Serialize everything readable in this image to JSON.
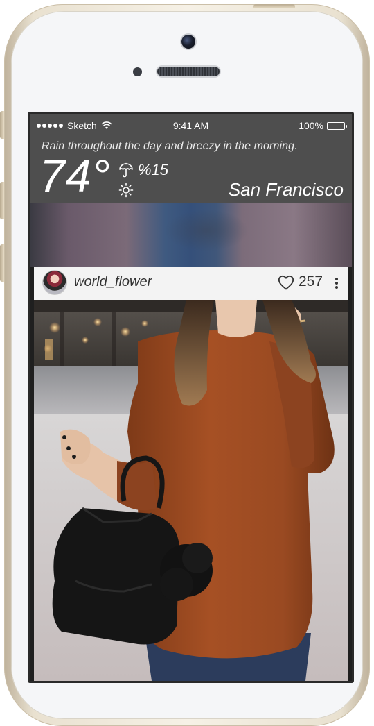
{
  "status_bar": {
    "carrier": "Sketch",
    "time": "9:41 AM",
    "battery": "100%"
  },
  "weather": {
    "forecast": "Rain throughout the day and breezy in the morning.",
    "temperature": "74°",
    "precipitation": "%15",
    "city": "San Francisco",
    "icons": [
      "umbrella-icon",
      "sun-icon"
    ]
  },
  "post": {
    "username": "world_flower",
    "likes": "257",
    "icons": [
      "avatar",
      "heart-icon",
      "more-icon"
    ]
  },
  "colors": {
    "header_bg": "#4e4e4e",
    "card_bg": "#f3f3f3",
    "sweater": "#9a4a22"
  }
}
